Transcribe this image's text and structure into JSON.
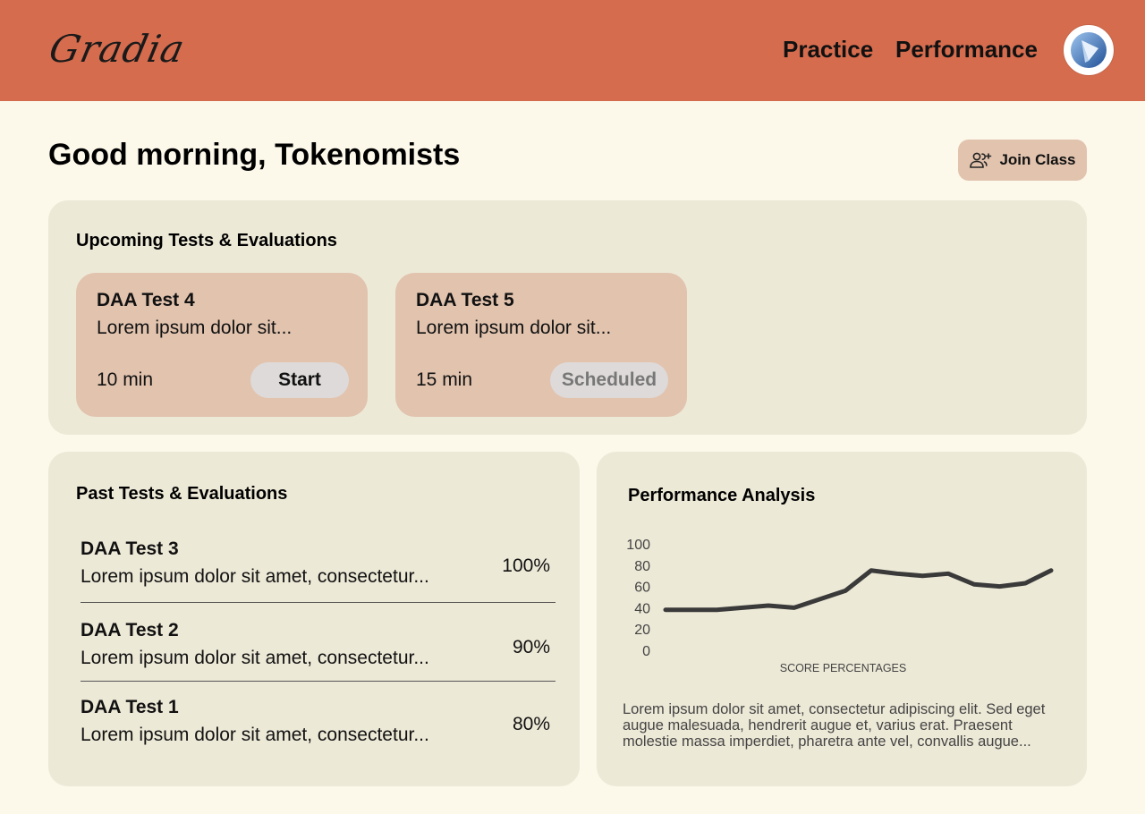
{
  "header": {
    "logo": "Gradia",
    "nav": [
      "Practice",
      "Performance"
    ],
    "avatar_icon": "play-logo-icon",
    "background": "#d66c4e"
  },
  "greeting": "Good morning, Tokenomists",
  "join_class": {
    "label": "Join Class",
    "icon": "add-user-icon"
  },
  "upcoming": {
    "title": "Upcoming Tests & Evaluations",
    "cards": [
      {
        "title": "DAA Test 4",
        "desc": "Lorem ipsum dolor sit...",
        "duration": "10 min",
        "action": "Start"
      },
      {
        "title": "DAA Test 5",
        "desc": "Lorem ipsum dolor sit...",
        "duration": "15 min",
        "action": "Scheduled"
      }
    ]
  },
  "past": {
    "title": "Past Tests & Evaluations",
    "items": [
      {
        "title": "DAA Test 3",
        "desc": "Lorem ipsum dolor sit amet, consectetur...",
        "score": "100%"
      },
      {
        "title": "DAA Test 2",
        "desc": "Lorem ipsum dolor sit amet, consectetur...",
        "score": "90%"
      },
      {
        "title": "DAA Test 1",
        "desc": "Lorem ipsum dolor sit amet, consectetur...",
        "score": "80%"
      }
    ]
  },
  "performance": {
    "title": "Performance Analysis",
    "description": "Lorem ipsum dolor sit amet, consectetur adipiscing elit. Sed eget augue malesuada, hendrerit augue et, varius erat. Praesent molestie massa imperdiet, pharetra ante vel, convallis augue..."
  },
  "chart_data": {
    "type": "line",
    "title": "",
    "xlabel": "SCORE PERCENTAGES",
    "ylabel": "",
    "yticks": [
      100,
      80,
      60,
      40,
      20,
      0
    ],
    "ylim": [
      0,
      100
    ],
    "grid": false,
    "series": [
      {
        "values": [
          38,
          38,
          38,
          40,
          42,
          40,
          48,
          56,
          75,
          72,
          70,
          72,
          62,
          60,
          63,
          75
        ]
      }
    ],
    "line_color": "#3a3a3a"
  }
}
